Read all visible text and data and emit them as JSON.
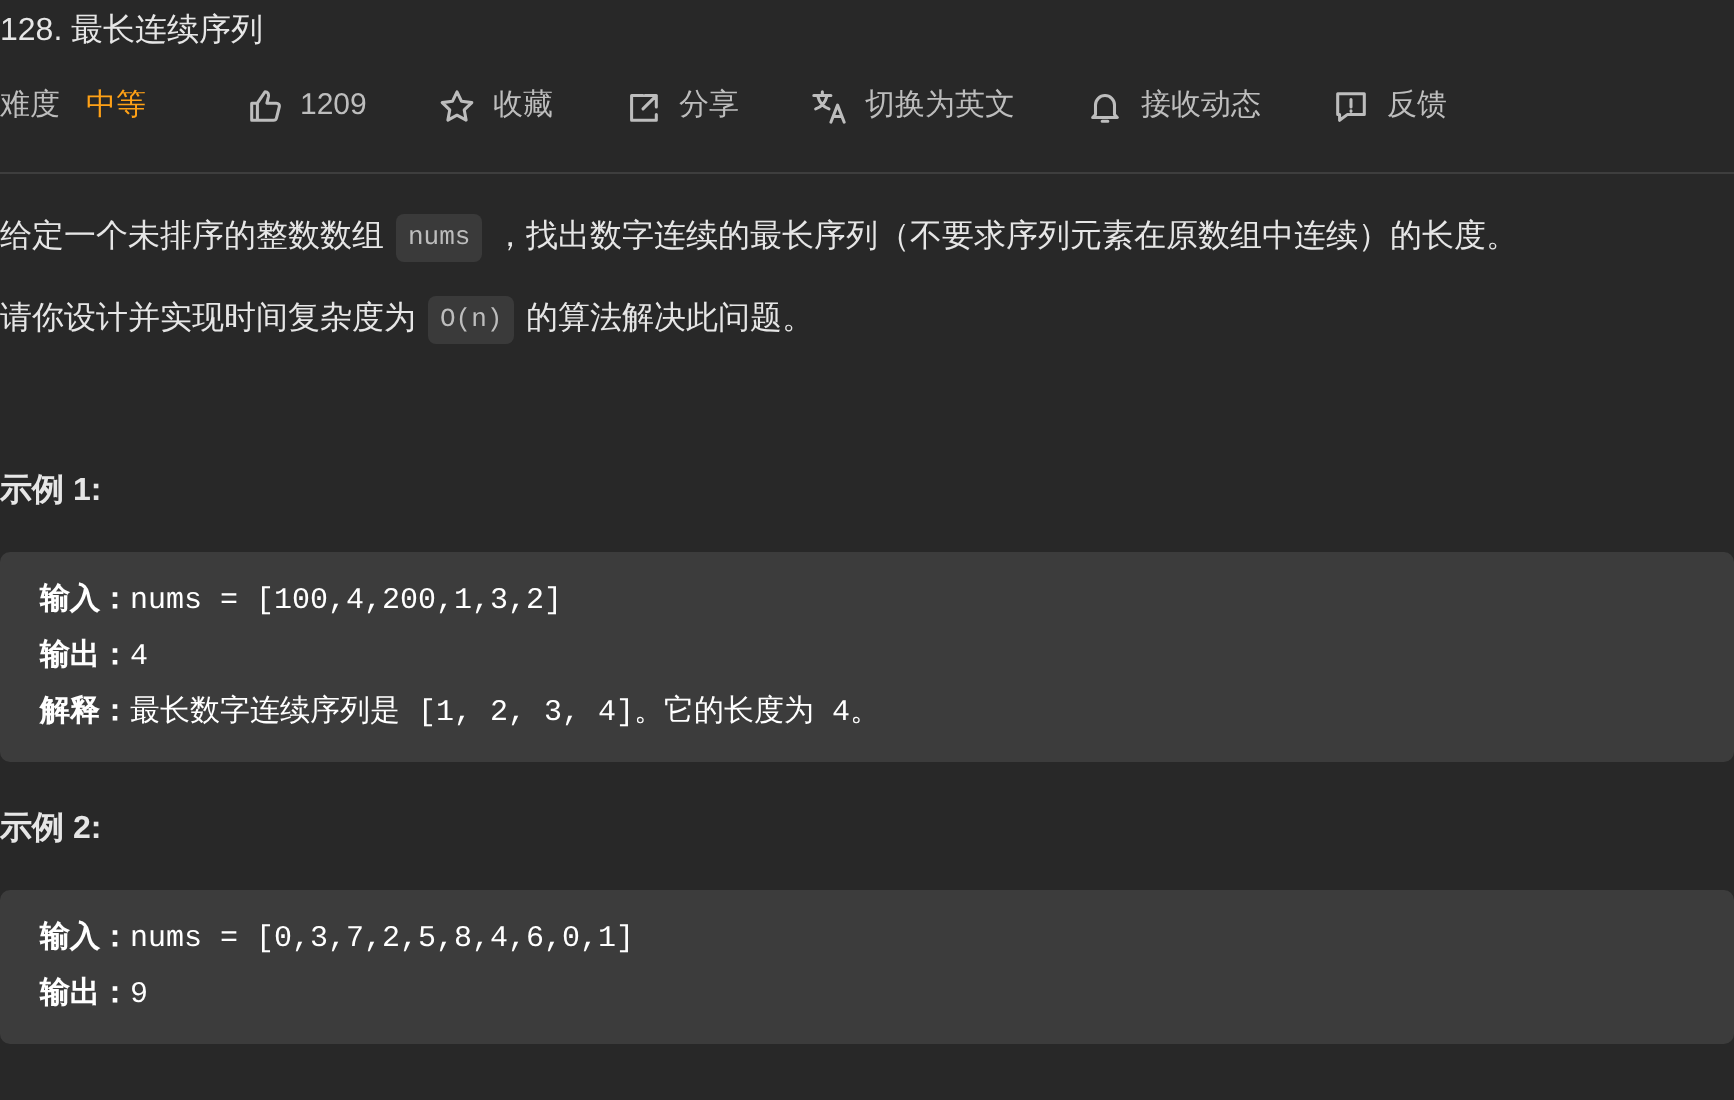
{
  "title": "128. 最长连续序列",
  "meta": {
    "difficulty_label": "难度",
    "difficulty": "中等",
    "actions": [
      {
        "label": "1209"
      },
      {
        "label": "收藏"
      },
      {
        "label": "分享"
      },
      {
        "label": "切换为英文"
      },
      {
        "label": "接收动态"
      },
      {
        "label": "反馈"
      }
    ]
  },
  "description": [
    [
      {
        "kind": "text",
        "text": "给定一个未排序的整数数组"
      },
      {
        "kind": "code",
        "text": "nums"
      },
      {
        "kind": "text",
        "text": "，找出数字连续的最长序列（不要求序列元素在原数组中连续）的长度。"
      }
    ],
    [
      {
        "kind": "text",
        "text": "请你设计并实现时间复杂度为"
      },
      {
        "kind": "code",
        "text": "O(n)"
      },
      {
        "kind": "text",
        "text": "的算法解决此问题。"
      }
    ]
  ],
  "examples": [
    {
      "heading": "示例 1:",
      "lines": [
        "**输入：**nums = [100,4,200,1,3,2]",
        "**输出：**4",
        "**解释：**最长数字连续序列是 [1, 2, 3, 4]。它的长度为 4。"
      ]
    },
    {
      "heading": "示例 2:",
      "lines": [
        "**输入：**nums = [0,3,7,2,5,8,4,6,0,1]",
        "**输出：**9"
      ]
    }
  ]
}
